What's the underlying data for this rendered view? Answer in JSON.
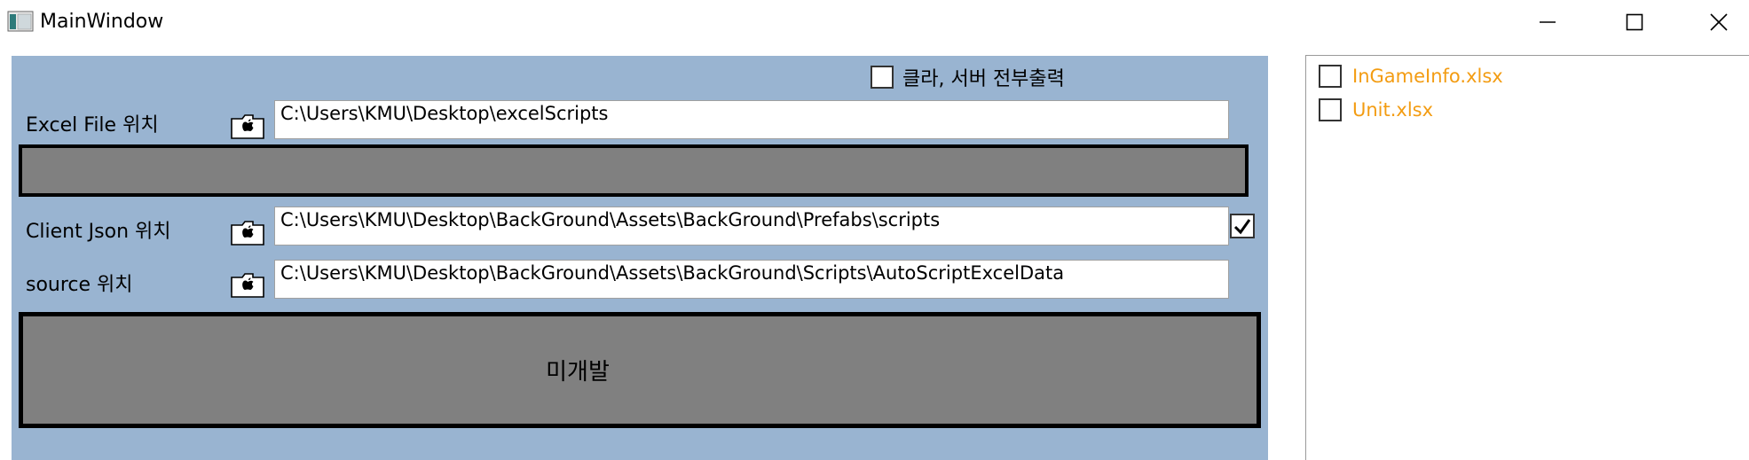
{
  "window": {
    "title": "MainWindow"
  },
  "main": {
    "all_output_label": "클라, 서버 전부출력",
    "all_output_checked": false,
    "excel": {
      "label": "Excel File 위치",
      "path": "C:\\Users\\KMU\\Desktop\\excelScripts"
    },
    "client_json": {
      "label": "Client Json 위치",
      "path": "C:\\Users\\KMU\\Desktop\\BackGround\\Assets\\BackGround\\Prefabs\\scripts",
      "checked": true
    },
    "source": {
      "label": "source 위치",
      "path": "C:\\Users\\KMU\\Desktop\\BackGround\\Assets\\BackGround\\Scripts\\AutoScriptExcelData"
    },
    "big_button_label": "미개발"
  },
  "files": [
    {
      "name": "InGameInfo.xlsx",
      "checked": false
    },
    {
      "name": "Unit.xlsx",
      "checked": false
    }
  ],
  "colors": {
    "panel_bg": "#99b4d1",
    "button_gray": "#808080",
    "file_name": "#f39c12"
  }
}
